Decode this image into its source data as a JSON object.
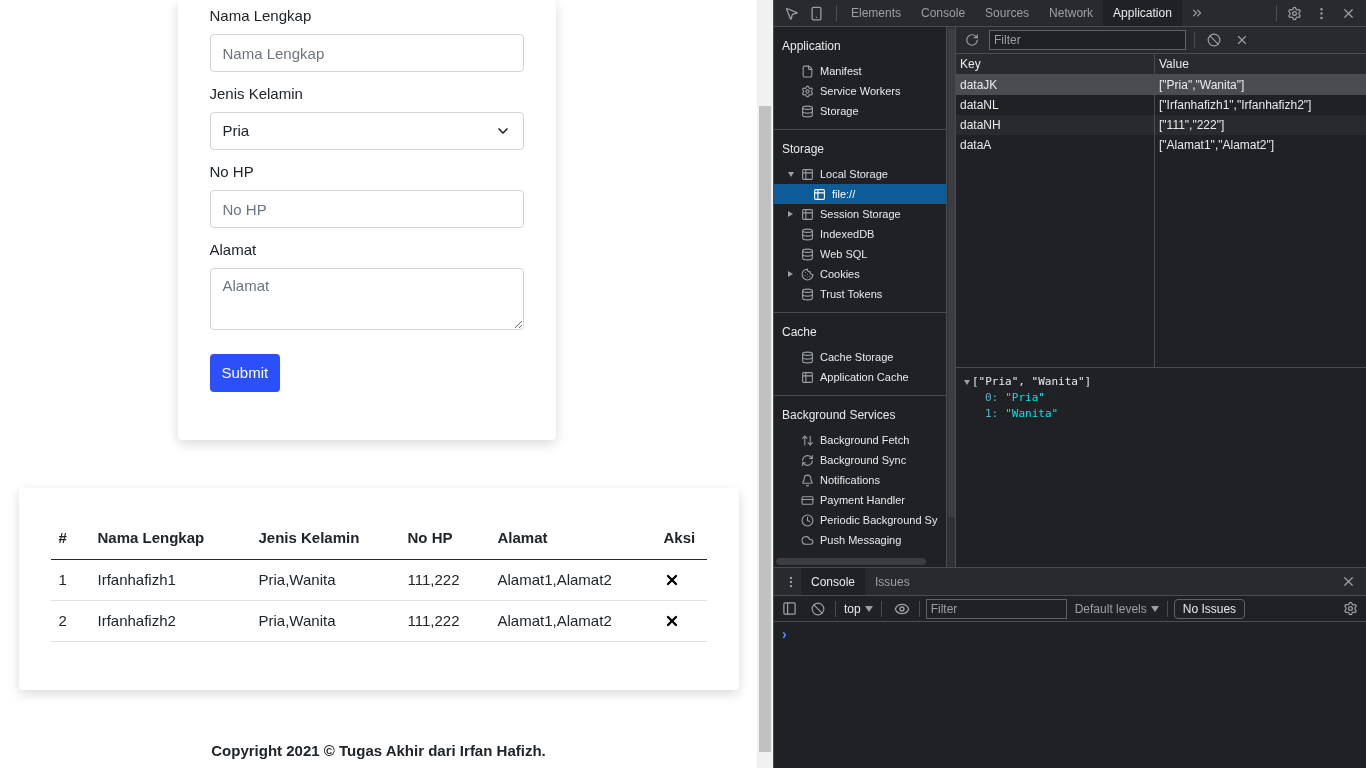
{
  "form": {
    "fields": [
      {
        "kind": "input",
        "label": "Nama Lengkap",
        "placeholder": "Nama Lengkap"
      },
      {
        "kind": "select",
        "label": "Jenis Kelamin",
        "value": "Pria"
      },
      {
        "kind": "input",
        "label": "No HP",
        "placeholder": "No HP"
      },
      {
        "kind": "textarea",
        "label": "Alamat",
        "placeholder": "Alamat"
      }
    ],
    "submit": "Submit"
  },
  "table": {
    "columns": [
      "#",
      "Nama Lengkap",
      "Jenis Kelamin",
      "No HP",
      "Alamat",
      "Aksi"
    ],
    "rows": [
      [
        "1",
        "Irfanhafizh1",
        "Pria,Wanita",
        "111,222",
        "Alamat1,Alamat2"
      ],
      [
        "2",
        "Irfanhafizh2",
        "Pria,Wanita",
        "111,222",
        "Alamat1,Alamat2"
      ]
    ]
  },
  "footer": "Copyright 2021 © Tugas Akhir dari Irfan Hafizh.",
  "devtools": {
    "tabs": [
      {
        "label": "Elements",
        "selected": false
      },
      {
        "label": "Console",
        "selected": false
      },
      {
        "label": "Sources",
        "selected": false
      },
      {
        "label": "Network",
        "selected": false
      },
      {
        "label": "Application",
        "selected": true
      }
    ],
    "sidebar": [
      {
        "title": "Application",
        "items": [
          {
            "label": "Manifest",
            "kind": "file",
            "selected": false
          },
          {
            "label": "Service Workers",
            "kind": "gear",
            "selected": false
          },
          {
            "label": "Storage",
            "kind": "database",
            "selected": false
          }
        ]
      },
      {
        "title": "Storage",
        "items": [
          {
            "label": "Local Storage",
            "kind": "grid",
            "selected": false,
            "expanded": true,
            "children": [
              {
                "label": "file://",
                "kind": "grid",
                "selected": true
              }
            ]
          },
          {
            "label": "Session Storage",
            "kind": "grid",
            "selected": false,
            "expanded": false
          },
          {
            "label": "IndexedDB",
            "kind": "database",
            "selected": false
          },
          {
            "label": "Web SQL",
            "kind": "database",
            "selected": false
          },
          {
            "label": "Cookies",
            "kind": "cookie",
            "selected": false,
            "expanded": false
          },
          {
            "label": "Trust Tokens",
            "kind": "database",
            "selected": false
          }
        ]
      },
      {
        "title": "Cache",
        "items": [
          {
            "label": "Cache Storage",
            "kind": "database",
            "selected": false
          },
          {
            "label": "Application Cache",
            "kind": "grid",
            "selected": false
          }
        ]
      },
      {
        "title": "Background Services",
        "items": [
          {
            "label": "Background Fetch",
            "kind": "arrows",
            "selected": false
          },
          {
            "label": "Background Sync",
            "kind": "sync",
            "selected": false
          },
          {
            "label": "Notifications",
            "kind": "bell",
            "selected": false
          },
          {
            "label": "Payment Handler",
            "kind": "card",
            "selected": false
          },
          {
            "label": "Periodic Background Sy",
            "kind": "clock",
            "selected": false
          },
          {
            "label": "Push Messaging",
            "kind": "cloud",
            "selected": false
          }
        ]
      }
    ],
    "filter_placeholder": "Filter",
    "storage_table": {
      "columns": [
        "Key",
        "Value"
      ],
      "rows": [
        {
          "key": "dataJK",
          "value": "[\"Pria\",\"Wanita\"]",
          "selected": true
        },
        {
          "key": "dataNL",
          "value": "[\"Irfanhafizh1\",\"Irfanhafizh2\"]",
          "selected": false
        },
        {
          "key": "dataNH",
          "value": "[\"111\",\"222\"]",
          "selected": false
        },
        {
          "key": "dataA",
          "value": "[\"Alamat1\",\"Alamat2\"]",
          "selected": false
        }
      ]
    },
    "preview": {
      "summary": "[\"Pria\", \"Wanita\"]",
      "expanded": true,
      "entries": [
        {
          "index": "0:",
          "value": "\"Pria\""
        },
        {
          "index": "1:",
          "value": "\"Wanita\""
        }
      ]
    },
    "drawer": {
      "tabs": [
        {
          "label": "Console",
          "selected": true
        },
        {
          "label": "Issues",
          "selected": false
        }
      ],
      "context": "top",
      "filter_placeholder": "Filter",
      "levels": "Default levels",
      "issues": "No Issues",
      "prompt": "›"
    }
  }
}
